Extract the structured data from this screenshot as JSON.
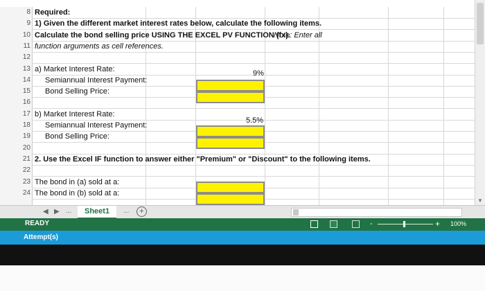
{
  "rows": [
    {
      "num": "8",
      "text": "Required:",
      "bold": true
    },
    {
      "num": "9",
      "text": "1) Given the different market interest rates below, calculate the following items.",
      "bold": true
    },
    {
      "num": "10",
      "text": "Calculate the bond selling price USING THE EXCEL PV FUNCTION (fx).",
      "text2": "Note: Enter all",
      "bold": true
    },
    {
      "num": "11",
      "text": "function arguments as cell references.",
      "italic": true
    },
    {
      "num": "12",
      "text": ""
    },
    {
      "num": "13",
      "text": "a) Market Interest Rate:",
      "value": "9%"
    },
    {
      "num": "14",
      "text": "Semiannual Interest Payment:"
    },
    {
      "num": "15",
      "text": "Bond Selling Price:"
    },
    {
      "num": "16",
      "text": ""
    },
    {
      "num": "17",
      "text": "b) Market Interest Rate:",
      "value": "5.5%"
    },
    {
      "num": "18",
      "text": "Semiannual Interest Payment:"
    },
    {
      "num": "19",
      "text": "Bond Selling Price:"
    },
    {
      "num": "20",
      "text": ""
    },
    {
      "num": "21",
      "text": "2. Use the Excel IF function to answer either \"Premium\" or \"Discount\" to the following items.",
      "bold": true
    },
    {
      "num": "22",
      "text": ""
    },
    {
      "num": "23",
      "text": "The bond in (a) sold at a:"
    },
    {
      "num": "24",
      "text": "The bond in (b) sold at a:"
    }
  ],
  "tabs": {
    "prev_arrow": "◀",
    "next_arrow": "▶",
    "ellipsis_left": "...",
    "sheet_name": "Sheet1",
    "ellipsis_right": "...",
    "add_sheet": "+"
  },
  "status": {
    "ready": "READY",
    "zoom": "100%",
    "minus": "-",
    "plus": "+"
  },
  "attempts_label": "Attempt(s)",
  "colors": {
    "status_bar": "#217346",
    "attempt_bar": "#1b9bd8",
    "answer_cell": "#fff200"
  }
}
